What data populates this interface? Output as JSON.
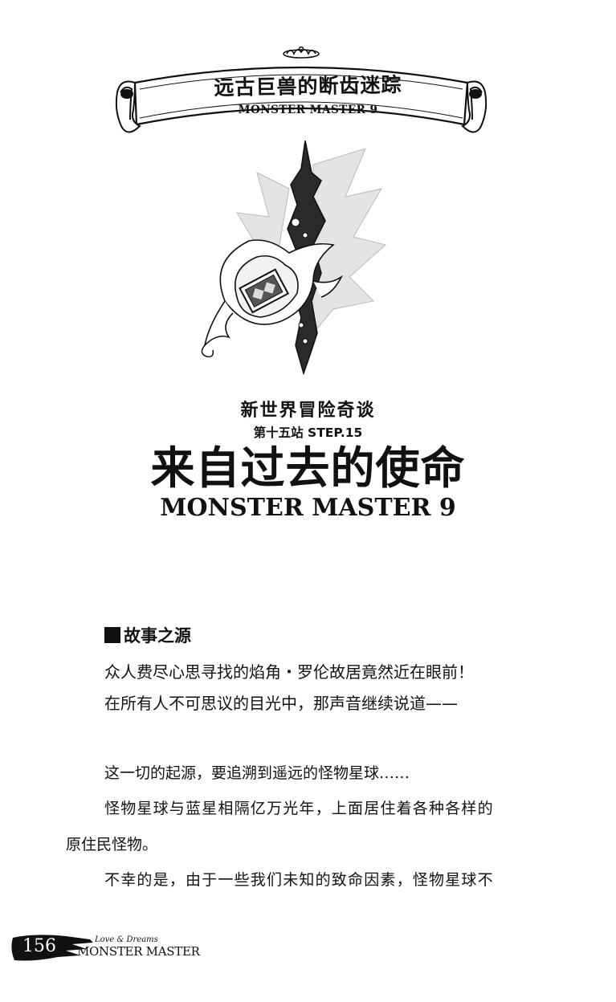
{
  "banner": {
    "title": "远古巨兽的断齿迷踪",
    "subtitle": "MONSTER MASTER 9"
  },
  "chapter": {
    "series": "新世界冒险奇谈",
    "step": "第十五站 STEP.15",
    "title": "来自过去的使命",
    "subtitle": "MONSTER MASTER 9"
  },
  "summary": {
    "heading": "故事之源",
    "lines": [
      "众人费尽心思寻找的焰角・罗伦故居竟然近在眼前！",
      "在所有人不可思议的目光中，那声音继续说道——"
    ]
  },
  "body": {
    "lines": [
      "这一切的起源，要追溯到遥远的怪物星球……",
      "怪物星球与蓝星相隔亿万光年，上面居住着各种各样的",
      "原住民怪物。",
      "不幸的是，由于一些我们未知的致命因素，怪物星球不"
    ]
  },
  "footer": {
    "page_number": "156",
    "tagline": "Love & Dreams",
    "brand": "MONSTER MASTER"
  },
  "illustration": {
    "icon": "flaming-card-emblem-icon"
  }
}
